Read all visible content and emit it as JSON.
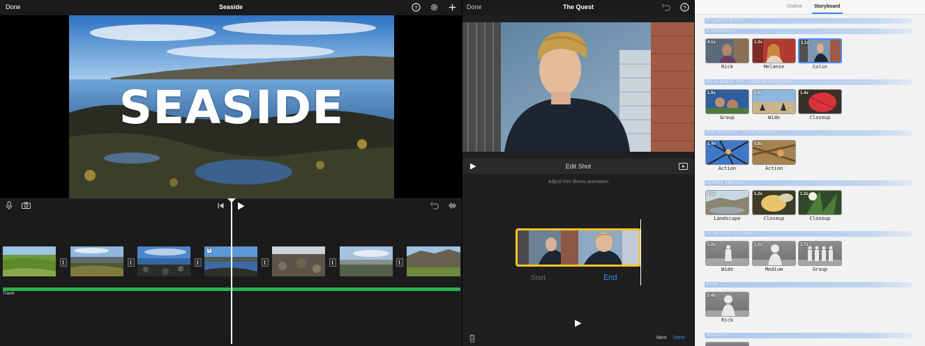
{
  "left": {
    "topbar": {
      "done": "Done",
      "title": "Seaside"
    },
    "overlay_title": "SEASIDE",
    "audio_track_label": "Travel",
    "accent_green": "#2bb150"
  },
  "middle": {
    "topbar": {
      "done": "Done",
      "title": "The Quest"
    },
    "edit": {
      "title": "Edit Shot",
      "subtitle": "Adjust Ken Burns animation",
      "start": "Start",
      "end": "End"
    },
    "bottom": {
      "next": "Next",
      "done": "Done"
    },
    "accent_blue": "#3e8ef7",
    "accent_yellow": "#f6c324"
  },
  "right": {
    "tabs": {
      "outline": "Outline",
      "storyboard": "Storyboard"
    },
    "sections": [
      {
        "title": "HighDef Films",
        "shots": []
      },
      {
        "title": "3 Students",
        "shots": [
          {
            "duration": "4.1s",
            "label": "Rick"
          },
          {
            "duration": "1.3s",
            "label": "Melanie"
          },
          {
            "duration": "1.1s",
            "label": "Colin"
          }
        ]
      },
      {
        "title": "on a quest for - hidden treasure",
        "shots": [
          {
            "duration": "1.0s",
            "label": "Group"
          },
          {
            "duration": "0.9s",
            "label": "Wide"
          },
          {
            "duration": "1.4s",
            "label": "Closeup"
          }
        ]
      },
      {
        "title": "will embark - on a journey",
        "shots": [
          {
            "duration": "2.4s",
            "label": "Action"
          },
          {
            "duration": "0.8s",
            "label": "Action"
          }
        ]
      },
      {
        "title": "across Mexico",
        "shots": [
          {
            "duration": "1.5s",
            "label": "Landscape"
          },
          {
            "duration": "1.2s",
            "label": "Closeup"
          },
          {
            "duration": "1.2s",
            "label": "Closeup"
          }
        ]
      },
      {
        "title": "in search of clues",
        "shots": [
          {
            "duration": "1.0s",
            "label": "Wide"
          },
          {
            "duration": "1.2s",
            "label": "Medium"
          },
          {
            "duration": "1.7s",
            "label": "Group"
          }
        ]
      },
      {
        "title": "Rick",
        "shots": [
          {
            "duration": "1.4s",
            "label": "Rick"
          }
        ]
      },
      {
        "title": "Melanie",
        "shots": []
      }
    ],
    "selected_accent": "#4a8ef2"
  }
}
